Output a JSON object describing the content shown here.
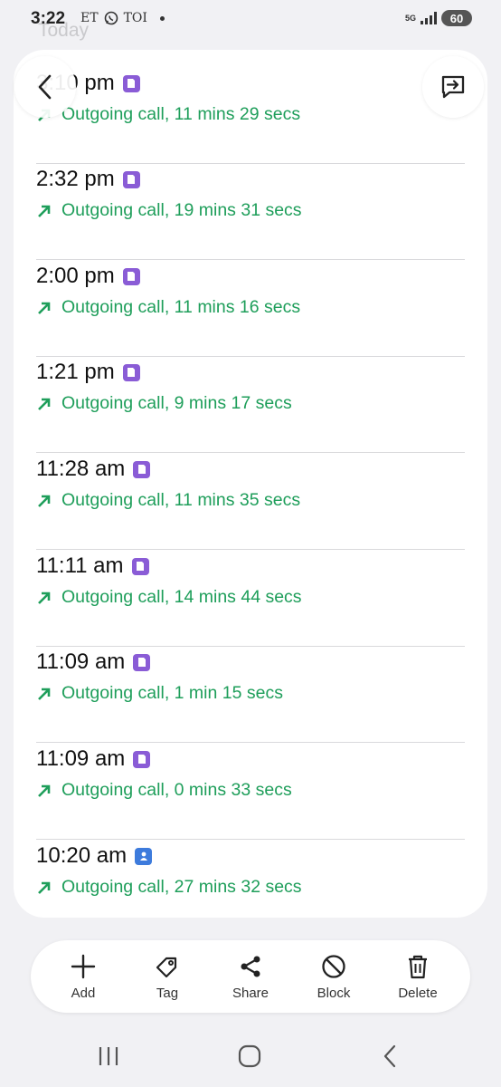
{
  "status_bar": {
    "time": "3:22",
    "app_label_1": "ET",
    "app_label_2": "TOI",
    "network": "5G",
    "battery": "60"
  },
  "header": {
    "ghost_title": "Today"
  },
  "call_log": [
    {
      "time": "3:10 pm",
      "sim": "purple",
      "detail": "Outgoing call, 11 mins 29 secs"
    },
    {
      "time": "2:32 pm",
      "sim": "purple",
      "detail": "Outgoing call, 19 mins 31 secs"
    },
    {
      "time": "2:00 pm",
      "sim": "purple",
      "detail": "Outgoing call, 11 mins 16 secs"
    },
    {
      "time": "1:21 pm",
      "sim": "purple",
      "detail": "Outgoing call, 9 mins 17 secs"
    },
    {
      "time": "11:28 am",
      "sim": "purple",
      "detail": "Outgoing call, 11 mins 35 secs"
    },
    {
      "time": "11:11 am",
      "sim": "purple",
      "detail": "Outgoing call, 14 mins 44 secs"
    },
    {
      "time": "11:09 am",
      "sim": "purple",
      "detail": "Outgoing call, 1 min 15 secs"
    },
    {
      "time": "11:09 am",
      "sim": "purple",
      "detail": "Outgoing call, 0 mins 33 secs"
    },
    {
      "time": "10:20 am",
      "sim": "blue",
      "detail": "Outgoing call, 27 mins 32 secs"
    }
  ],
  "actions": [
    {
      "label": "Add",
      "icon": "plus-icon"
    },
    {
      "label": "Tag",
      "icon": "tag-icon"
    },
    {
      "label": "Share",
      "icon": "share-icon"
    },
    {
      "label": "Block",
      "icon": "block-icon"
    },
    {
      "label": "Delete",
      "icon": "trash-icon"
    }
  ],
  "colors": {
    "outgoing_green": "#1e9e5a",
    "sim_purple": "#8a5cd6",
    "contact_blue": "#3d7bdc"
  }
}
